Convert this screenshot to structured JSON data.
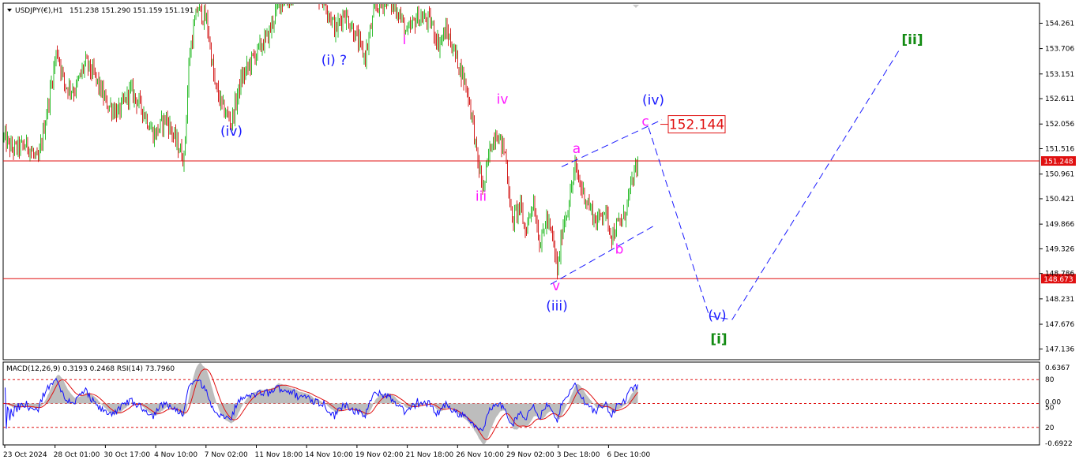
{
  "header": {
    "symbol": "USDJPY(€),H1",
    "ohlc": "151.238 151.290 151.159 151.191"
  },
  "indicator_header": "MACD(12,26,9) 0.3193 0.2468 RSI(14) 73.7960",
  "colors": {
    "bull": "#2ebd2e",
    "bear": "#d42020",
    "wave_blue": "#1a1aff",
    "wave_magenta": "#ff19ff",
    "wave_green": "#118a11",
    "level_line": "#e01010",
    "rsi": "#1010ff",
    "macd_signal": "#e01010",
    "macd_hist": "#bdbdbd"
  },
  "chart_data": [
    {
      "type": "candlestick",
      "timeframe": "H1",
      "ylim": [
        146.9,
        154.7
      ],
      "y_ticks": [
        "154.261",
        "153.706",
        "153.151",
        "152.611",
        "152.056",
        "151.516",
        "150.961",
        "150.421",
        "149.866",
        "149.326",
        "148.786",
        "148.231",
        "147.676",
        "147.136"
      ],
      "x_ticks": [
        "23 Oct 2024",
        "28 Oct 01:00",
        "30 Oct 17:00",
        "4 Nov 10:00",
        "7 Nov 02:00",
        "11 Nov 18:00",
        "14 Nov 10:00",
        "19 Nov 02:00",
        "21 Nov 18:00",
        "26 Nov 10:00",
        "29 Nov 02:00",
        "3 Dec 18:00",
        "6 Dec 10:00"
      ],
      "price_path": [
        [
          0,
          151.9
        ],
        [
          15,
          151.5
        ],
        [
          35,
          151.6
        ],
        [
          48,
          151.2
        ],
        [
          62,
          152.6
        ],
        [
          72,
          153.7
        ],
        [
          82,
          152.9
        ],
        [
          95,
          152.8
        ],
        [
          108,
          153.4
        ],
        [
          120,
          153.1
        ],
        [
          135,
          152.5
        ],
        [
          150,
          152.3
        ],
        [
          165,
          152.8
        ],
        [
          180,
          152.4
        ],
        [
          195,
          151.8
        ],
        [
          210,
          152.2
        ],
        [
          222,
          151.7
        ],
        [
          233,
          151.3
        ],
        [
          240,
          153.6
        ],
        [
          250,
          154.6
        ],
        [
          262,
          154.3
        ],
        [
          272,
          152.9
        ],
        [
          282,
          152.4
        ],
        [
          293,
          152.1
        ],
        [
          305,
          153.0
        ],
        [
          320,
          153.5
        ],
        [
          340,
          154.0
        ],
        [
          352,
          154.7
        ],
        [
          365,
          154.8
        ],
        [
          390,
          155.0
        ],
        [
          410,
          154.8
        ],
        [
          425,
          154.1
        ],
        [
          435,
          154.5
        ],
        [
          445,
          154.2
        ],
        [
          462,
          153.5
        ],
        [
          475,
          154.6
        ],
        [
          490,
          154.8
        ],
        [
          505,
          154.5
        ],
        [
          515,
          154.0
        ],
        [
          528,
          154.4
        ],
        [
          545,
          154.3
        ],
        [
          555,
          153.8
        ],
        [
          565,
          154.1
        ],
        [
          578,
          153.5
        ],
        [
          590,
          152.9
        ],
        [
          598,
          152.2
        ],
        [
          604,
          151.3
        ],
        [
          612,
          150.6
        ],
        [
          620,
          151.5
        ],
        [
          628,
          151.9
        ],
        [
          640,
          151.4
        ],
        [
          648,
          149.9
        ],
        [
          658,
          150.3
        ],
        [
          665,
          149.7
        ],
        [
          675,
          150.4
        ],
        [
          684,
          149.4
        ],
        [
          692,
          150.0
        ],
        [
          700,
          149.5
        ],
        [
          706,
          148.8
        ],
        [
          712,
          149.8
        ],
        [
          720,
          150.3
        ],
        [
          728,
          151.1
        ],
        [
          735,
          150.7
        ],
        [
          745,
          150.3
        ],
        [
          755,
          149.9
        ],
        [
          765,
          150.2
        ],
        [
          775,
          149.6
        ],
        [
          780,
          149.8
        ],
        [
          790,
          150.0
        ],
        [
          796,
          150.5
        ],
        [
          802,
          150.9
        ],
        [
          808,
          151.2
        ]
      ],
      "levels": [
        {
          "name": "current-price",
          "value": 151.248,
          "label": "151.248"
        },
        {
          "name": "support",
          "value": 148.673,
          "label": "148.673"
        }
      ],
      "target": {
        "value": "152.144"
      },
      "wave_labels": [
        {
          "text": "(i) ?",
          "color": "blue",
          "t": 423,
          "price": 153.35
        },
        {
          "text": "(iv)",
          "color": "blue",
          "t": 293,
          "price": 151.8
        },
        {
          "text": "i",
          "color": "magenta",
          "t": 512,
          "price": 153.8
        },
        {
          "text": "iv",
          "color": "magenta",
          "t": 636,
          "price": 152.5
        },
        {
          "text": "iii",
          "color": "magenta",
          "t": 609,
          "price": 150.38
        },
        {
          "text": "a",
          "color": "magenta",
          "t": 730,
          "price": 151.42
        },
        {
          "text": "b",
          "color": "magenta",
          "t": 784,
          "price": 149.22
        },
        {
          "text": "v",
          "color": "magenta",
          "t": 704,
          "price": 148.42
        },
        {
          "text": "(iii)",
          "color": "blue",
          "t": 705,
          "price": 147.98
        },
        {
          "text": "(iv)",
          "color": "blue",
          "t": 827,
          "price": 152.48
        },
        {
          "text": "c",
          "color": "magenta",
          "t": 817,
          "price": 152.02
        },
        {
          "text": "(v)",
          "color": "blue",
          "t": 908,
          "price": 147.77
        },
        {
          "text": "[i]",
          "color": "green",
          "t": 910,
          "price": 147.25
        },
        {
          "text": "[ii]",
          "color": "green",
          "t": 1155,
          "price": 153.8
        }
      ],
      "projection": [
        [
          821,
          151.98
        ],
        [
          898,
          147.85
        ],
        [
          927,
          147.78
        ],
        [
          1140,
          153.72
        ]
      ],
      "channel": [
        {
          "from": [
            711,
            151.12
          ],
          "to": [
            838,
            152.15
          ]
        },
        {
          "from": [
            697,
            148.55
          ],
          "to": [
            829,
            149.84
          ]
        }
      ]
    },
    {
      "type": "line",
      "title": "MACD(12,26,9) 0.3193 0.2468 RSI(14) 73.7960",
      "right_ticks": [
        "0.6367",
        "80",
        "0.00",
        "50",
        "20",
        "-0.6922"
      ],
      "rsi_levels": [
        80,
        50,
        20
      ],
      "last_rsi": 73.796
    }
  ]
}
